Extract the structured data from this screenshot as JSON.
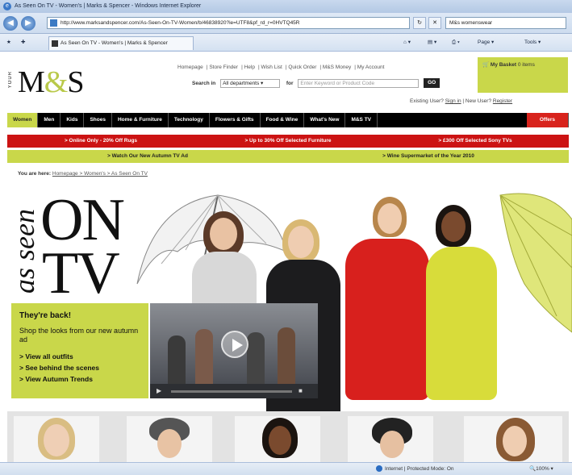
{
  "browser": {
    "window_title": "As Seen On TV - Women's | Marks & Spencer - Windows Internet Explorer",
    "url": "http://www.marksandspencer.com/As-Seen-On-TV-Women/b/46838920?ie=UTF8&pf_rd_r=0HVTQ45R",
    "search_value": "M&s womenswear",
    "tab_title": "As Seen On TV - Women's | Marks & Spencer",
    "page_menu": "Page",
    "tools_menu": "Tools",
    "status_zone": "Internet | Protected Mode: On",
    "status_zoom": "100%"
  },
  "site": {
    "logo_your": "YOUR",
    "logo_m": "M",
    "logo_amp": "&",
    "logo_s": "S",
    "top_links": [
      "Homepage",
      "Store Finder",
      "Help",
      "Wish List",
      "Quick Order",
      "M&S Money",
      "My Account"
    ],
    "search_label": "Search in",
    "search_select": "All departments",
    "search_for": "for",
    "search_placeholder": "Enter Keyword or Product Code",
    "search_go": "GO",
    "basket_label": "My Basket",
    "basket_count": "0 items",
    "existing_user": "Existing User?",
    "sign_in": "Sign in",
    "new_user": "New User?",
    "register": "Register"
  },
  "nav": {
    "items": [
      "Women",
      "Men",
      "Kids",
      "Shoes",
      "Home & Furniture",
      "Technology",
      "Flowers & Gifts",
      "Food & Wine",
      "What's New",
      "M&S TV"
    ],
    "offers": "Offers"
  },
  "promos_red": [
    "> Online Only - 20% Off Rugs",
    "> Up to 30% Off Selected Furniture",
    "> £300 Off Selected Sony TVs"
  ],
  "promos_green": [
    "> Watch Our New Autumn TV Ad",
    "> Wine Supermarket of the Year 2010"
  ],
  "breadcrumb": {
    "label": "You are here:",
    "path": "Homepage > Women's > As Seen On TV"
  },
  "hero": {
    "as_seen": "as seen",
    "on": "ON",
    "tv": "TV",
    "heading": "They're back!",
    "text": "Shop the looks from our new autumn ad",
    "links": [
      "> View all outfits",
      "> See behind the scenes",
      "> View Autumn Trends"
    ]
  },
  "colors": {
    "accent_lime": "#c9d74a",
    "offer_red": "#d8231c",
    "nav_black": "#000000"
  }
}
